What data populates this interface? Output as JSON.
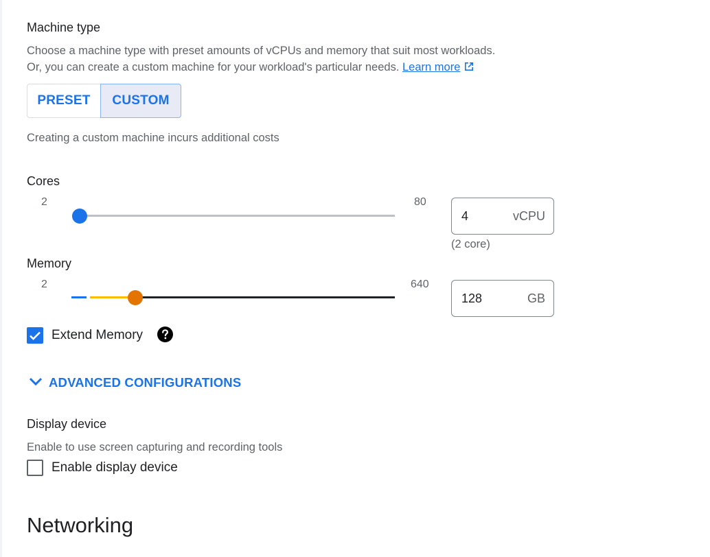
{
  "machine_type": {
    "title": "Machine type",
    "desc_line1": "Choose a machine type with preset amounts of vCPUs and memory that suit most workloads.",
    "desc_line2": "Or, you can create a custom machine for your workload's particular needs.",
    "learn_more": "Learn more",
    "tabs": {
      "preset": "PRESET",
      "custom": "CUSTOM",
      "selected": "custom"
    },
    "custom_note": "Creating a custom machine incurs additional costs"
  },
  "cores": {
    "label": "Cores",
    "min": "2",
    "max": "80",
    "value": "4",
    "unit": "vCPU",
    "sub": "(2 core)"
  },
  "memory": {
    "label": "Memory",
    "min": "2",
    "max": "640",
    "value": "128",
    "unit": "GB"
  },
  "extend_memory": {
    "label": "Extend Memory",
    "checked": true
  },
  "advanced": {
    "label": "ADVANCED CONFIGURATIONS"
  },
  "display_device": {
    "title": "Display device",
    "desc": "Enable to use screen capturing and recording tools",
    "checkbox_label": "Enable display device",
    "checked": false
  },
  "networking": {
    "title": "Networking"
  },
  "colors": {
    "accent": "#1a73e8",
    "memory_thumb": "#e37400",
    "memory_extended_track": "#fbbc04"
  }
}
